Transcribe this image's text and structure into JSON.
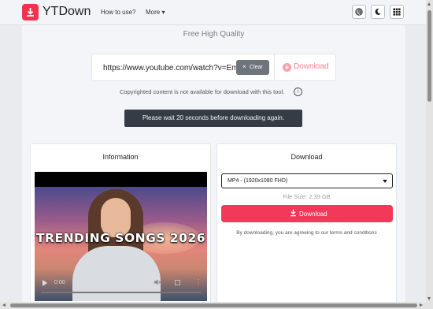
{
  "navbar": {
    "brand": "YTDown",
    "links": [
      "How to use?",
      "More ▾"
    ]
  },
  "hero": {
    "tagline": "Free High Quality"
  },
  "url_bar": {
    "value": "https://www.youtube.com/watch?v=Em",
    "clear_icon": "×",
    "clear_label": "Clear",
    "download_label": "Download"
  },
  "notice": {
    "text": "Copyrighted content is not available for download with this tool.",
    "info_icon": "i"
  },
  "wait_banner": "Please wait 20 seconds before downloading again.",
  "info_card": {
    "title": "Information",
    "video": {
      "caption": "TRENDING SONGS 2026",
      "time": "0:00"
    }
  },
  "download_card": {
    "title": "Download",
    "format_selected": "MP4 - (1920x1080 FHD)",
    "file_size": "File Size: 2.39 GB",
    "button_label": "Download",
    "agreement": "By downloading, you are agreeing to our terms and conditions"
  },
  "colors": {
    "brand": "#f2334e",
    "download_button": "#f43859",
    "banner": "#353c46",
    "clear_button": "#6f737b"
  },
  "icons": [
    "download-logo-icon",
    "globe-icon",
    "moon-icon",
    "grid-icon",
    "info-icon",
    "play-icon",
    "volume-icon",
    "fullscreen-icon",
    "more-icon"
  ]
}
